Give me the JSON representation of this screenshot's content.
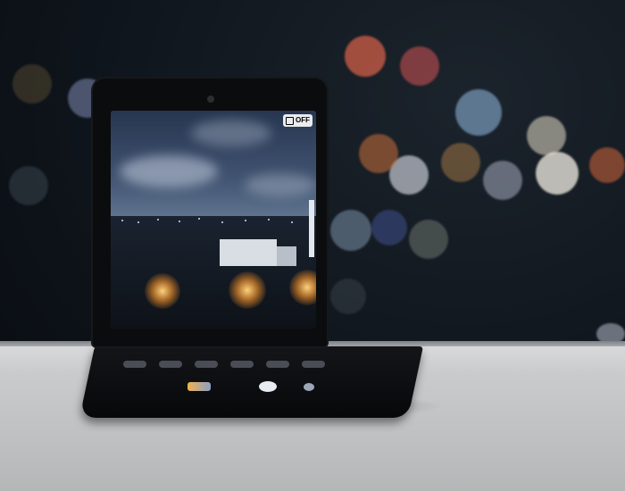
{
  "camera": {
    "flash_label": "OFF"
  },
  "icons": {
    "flash": "flash-off-icon",
    "front_camera": "front-camera-icon",
    "shutter": "shutter-icon",
    "switch_camera": "switch-camera-icon"
  },
  "colors": {
    "sky_top": "#273650",
    "city_glow": "#ffd07a",
    "sill": "#c9cbcc",
    "phone_body": "#0b0c0e"
  }
}
